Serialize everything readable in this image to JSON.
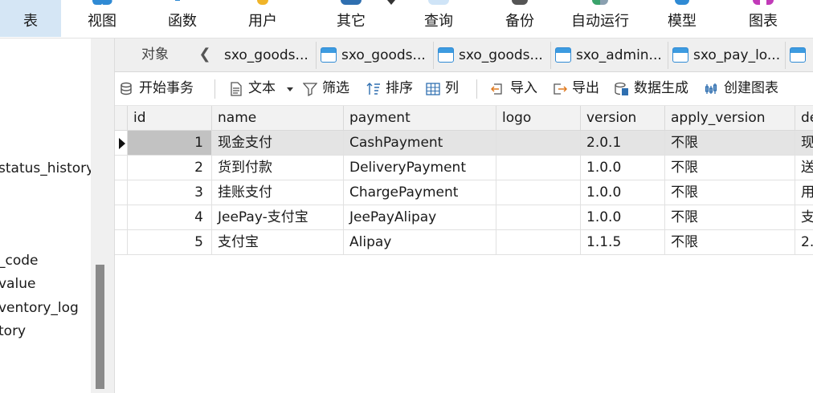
{
  "ribbon": {
    "items": [
      {
        "label": "表",
        "icon": "table-icon"
      },
      {
        "label": "视图",
        "icon": "view-icon"
      },
      {
        "label": "函数",
        "icon": "function-icon"
      },
      {
        "label": "用户",
        "icon": "user-icon"
      },
      {
        "label": "其它",
        "icon": "other-icon"
      },
      {
        "label": "查询",
        "icon": "query-icon"
      },
      {
        "label": "备份",
        "icon": "backup-icon"
      },
      {
        "label": "自动运行",
        "icon": "automation-icon"
      },
      {
        "label": "模型",
        "icon": "model-icon"
      },
      {
        "label": "图表",
        "icon": "chart-icon"
      }
    ]
  },
  "navigator": {
    "items": [
      "status_history",
      "_code",
      "value",
      "ventory_log",
      "tory"
    ]
  },
  "tabs": {
    "object_label": "对象",
    "items": [
      "sxo_goods...",
      "sxo_goods...",
      "sxo_goods...",
      "sxo_admin...",
      "sxo_pay_lo...",
      ""
    ]
  },
  "toolbar": {
    "begin_transaction": "开始事务",
    "text": "文本",
    "filter": "筛选",
    "sort": "排序",
    "columns": "列",
    "import": "导入",
    "export": "导出",
    "data_generation": "数据生成",
    "create_chart": "创建图表"
  },
  "grid": {
    "columns": [
      "id",
      "name",
      "payment",
      "logo",
      "version",
      "apply_version",
      "de"
    ],
    "rows": [
      {
        "id": "1",
        "name": "现金支付",
        "payment": "CashPayment",
        "logo": "",
        "version": "2.0.1",
        "apply_version": "不限",
        "de": "现"
      },
      {
        "id": "2",
        "name": "货到付款",
        "payment": "DeliveryPayment",
        "logo": "",
        "version": "1.0.0",
        "apply_version": "不限",
        "de": "送"
      },
      {
        "id": "3",
        "name": "挂账支付",
        "payment": "ChargePayment",
        "logo": "",
        "version": "1.0.0",
        "apply_version": "不限",
        "de": "用"
      },
      {
        "id": "4",
        "name": "JeePay-支付宝",
        "payment": "JeePayAlipay",
        "logo": "",
        "version": "1.0.0",
        "apply_version": "不限",
        "de": "支"
      },
      {
        "id": "5",
        "name": "支付宝",
        "payment": "Alipay",
        "logo": "",
        "version": "1.1.5",
        "apply_version": "不限",
        "de": "2."
      }
    ],
    "selected_row": 1
  },
  "colors": {
    "ribbon_active_bg": "#d5e6f5",
    "tab_icon_blue": "#3d9be0",
    "selected_row_bg": "#e4e4e4"
  }
}
